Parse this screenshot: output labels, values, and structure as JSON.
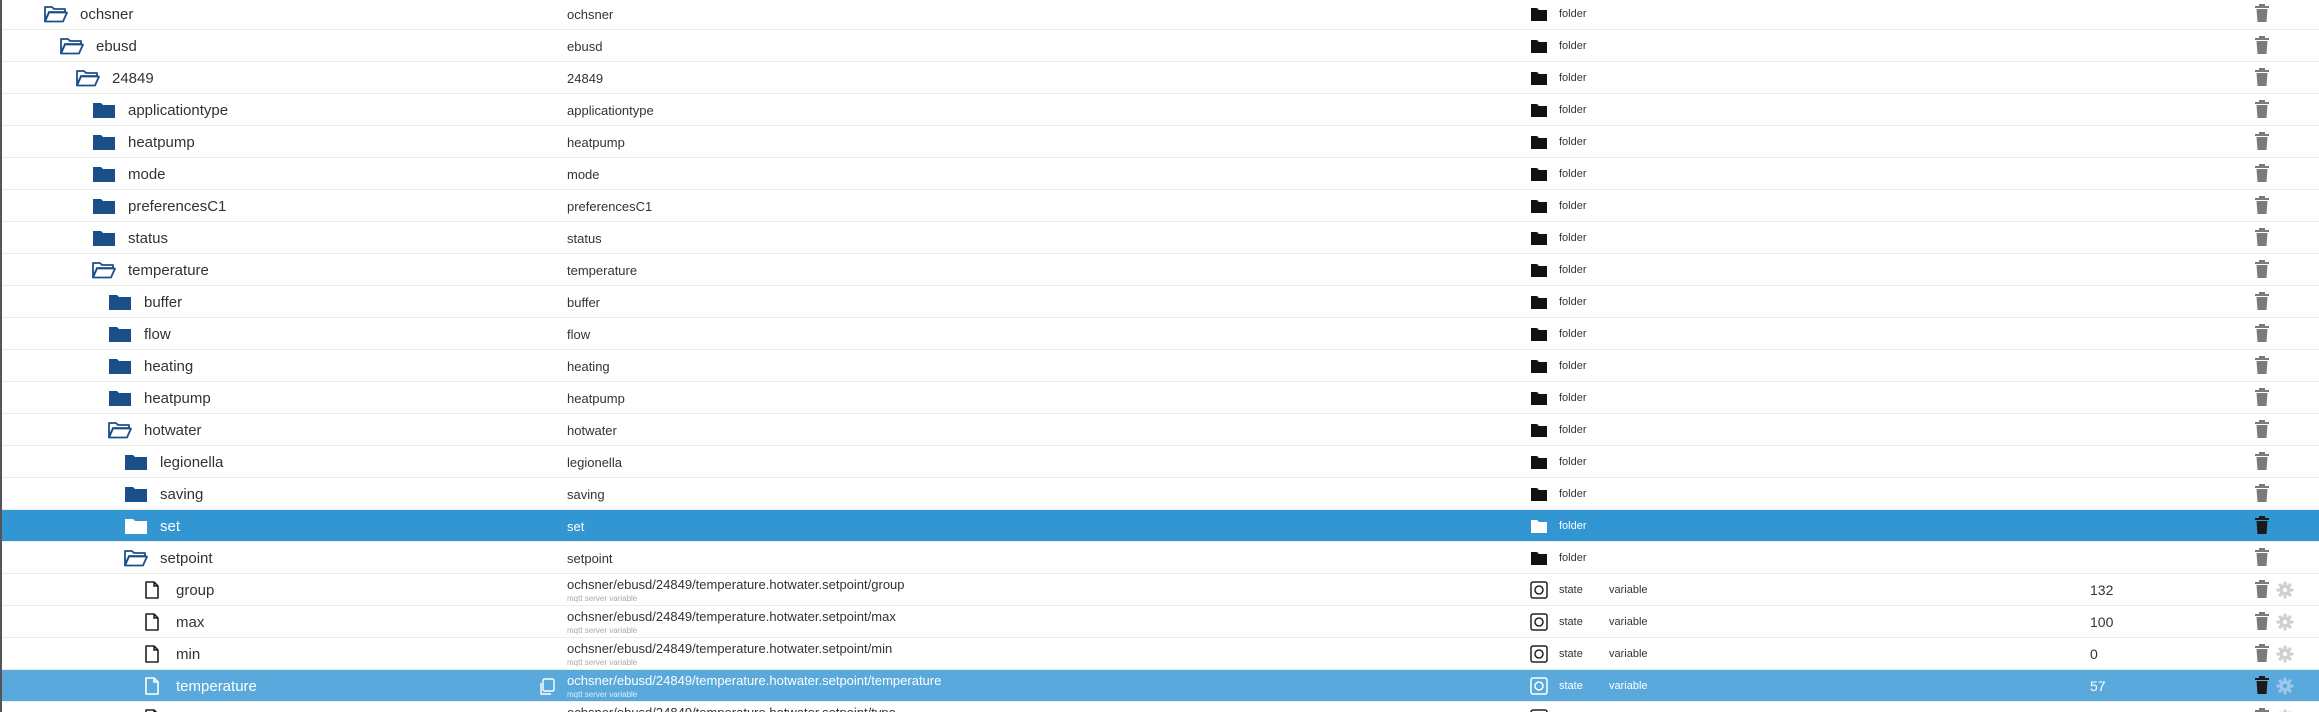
{
  "colors": {
    "folder_blue": "#1b4f8a",
    "selected_row": "#3296d2",
    "selected_row_light": "#5aa9dc",
    "delete_grey": "#7a7a7a",
    "gear_grey": "#cfcfcf"
  },
  "columns": {
    "folder_type_label": "folder",
    "state_type_label": "state",
    "variable_role_label": "variable",
    "mqtt_note": "mqtt server variable"
  },
  "rows": [
    {
      "label": "ochsner",
      "id": "ochsner",
      "kind": "folder",
      "open": true,
      "level": 0
    },
    {
      "label": "ebusd",
      "id": "ebusd",
      "kind": "folder",
      "open": true,
      "level": 1
    },
    {
      "label": "24849",
      "id": "24849",
      "kind": "folder",
      "open": true,
      "level": 2
    },
    {
      "label": "applicationtype",
      "id": "applicationtype",
      "kind": "folder",
      "open": false,
      "level": 3
    },
    {
      "label": "heatpump",
      "id": "heatpump",
      "kind": "folder",
      "open": false,
      "level": 3
    },
    {
      "label": "mode",
      "id": "mode",
      "kind": "folder",
      "open": false,
      "level": 3
    },
    {
      "label": "preferencesC1",
      "id": "preferencesC1",
      "kind": "folder",
      "open": false,
      "level": 3
    },
    {
      "label": "status",
      "id": "status",
      "kind": "folder",
      "open": false,
      "level": 3
    },
    {
      "label": "temperature",
      "id": "temperature",
      "kind": "folder",
      "open": true,
      "level": 3
    },
    {
      "label": "buffer",
      "id": "buffer",
      "kind": "folder",
      "open": false,
      "level": 4
    },
    {
      "label": "flow",
      "id": "flow",
      "kind": "folder",
      "open": false,
      "level": 4
    },
    {
      "label": "heating",
      "id": "heating",
      "kind": "folder",
      "open": false,
      "level": 4
    },
    {
      "label": "heatpump",
      "id": "heatpump",
      "kind": "folder",
      "open": false,
      "level": 4
    },
    {
      "label": "hotwater",
      "id": "hotwater",
      "kind": "folder",
      "open": true,
      "level": 4
    },
    {
      "label": "legionella",
      "id": "legionella",
      "kind": "folder",
      "open": false,
      "level": 5
    },
    {
      "label": "saving",
      "id": "saving",
      "kind": "folder",
      "open": false,
      "level": 5
    },
    {
      "label": "set",
      "id": "set",
      "kind": "folder",
      "open": false,
      "level": 5,
      "selected": true
    },
    {
      "label": "setpoint",
      "id": "setpoint",
      "kind": "folder",
      "open": true,
      "level": 5
    },
    {
      "label": "group",
      "id": "ochsner/ebusd/24849/temperature.hotwater.setpoint/group",
      "kind": "state",
      "level": 6,
      "value": "132"
    },
    {
      "label": "max",
      "id": "ochsner/ebusd/24849/temperature.hotwater.setpoint/max",
      "kind": "state",
      "level": 6,
      "value": "100"
    },
    {
      "label": "min",
      "id": "ochsner/ebusd/24849/temperature.hotwater.setpoint/min",
      "kind": "state",
      "level": 6,
      "value": "0"
    },
    {
      "label": "temperature",
      "id": "ochsner/ebusd/24849/temperature.hotwater.setpoint/temperature",
      "kind": "state",
      "level": 6,
      "value": "57",
      "hover": true
    },
    {
      "label": "",
      "id": "ochsner/ebusd/24849/temperature.hotwater.setpoint/type",
      "kind": "state",
      "level": 6,
      "value": ""
    }
  ]
}
